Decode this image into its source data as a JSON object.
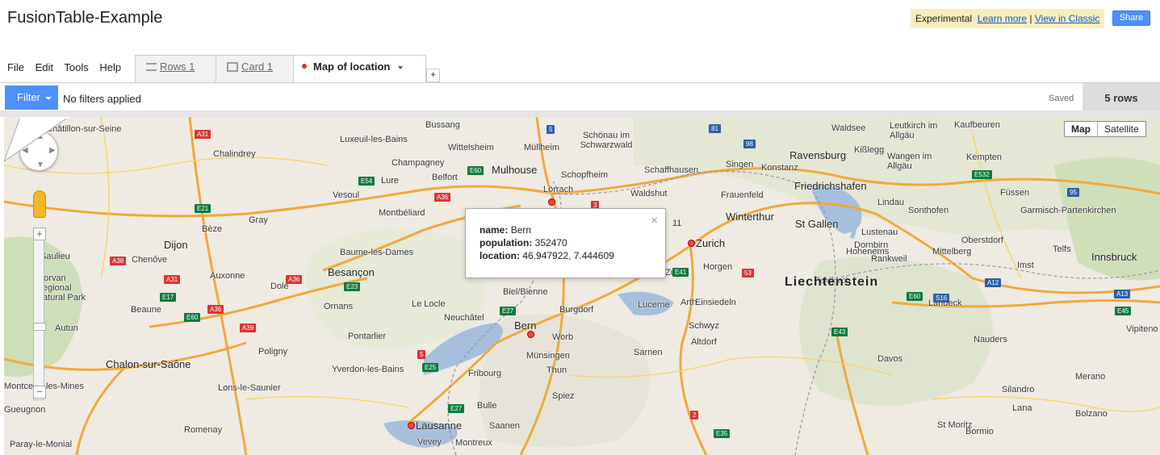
{
  "app": {
    "title": "FusionTable-Example",
    "experimental_label": "Experimental",
    "learn_more": "Learn more",
    "separator": "|",
    "view_classic": "View in Classic",
    "share_label": "Share"
  },
  "menu": [
    "File",
    "Edit",
    "Tools",
    "Help"
  ],
  "tabs": [
    {
      "label": "Rows 1",
      "icon": "rows-icon"
    },
    {
      "label": "Card 1",
      "icon": "card-icon"
    },
    {
      "label": "Map of location",
      "icon": "map-pin-icon"
    }
  ],
  "add_tab_label": "+",
  "filterbar": {
    "filter_label": "Filter",
    "no_filters": "No filters applied",
    "saved": "Saved",
    "rows_count": "5 rows"
  },
  "map": {
    "type_buttons": {
      "map": "Map",
      "satellite": "Satellite"
    },
    "zoom_in": "+",
    "zoom_out": "−",
    "info": {
      "name_key": "name:",
      "name_value": "Bern",
      "population_key": "population:",
      "population_value": "352470",
      "location_key": "location:",
      "location_value": "46.947922, 7.444609",
      "close": "×"
    },
    "country_label": "Liechtenstein",
    "cities": [
      "Châtillon-sur-Seine",
      "Bussang",
      "Schönau im Schwarzwald",
      "Luxeuil-les-Bains",
      "Wittelsheim",
      "Müllheim",
      "Chalindrey",
      "Champagney",
      "Mulhouse",
      "Schopfheim",
      "Belfort",
      "Lörrach",
      "Waldshut",
      "Schaffhausen",
      "Singen",
      "Konstanz",
      "Ravensburg",
      "Kißlegg",
      "Kaufbeuren",
      "Leutkirch im Allgäu",
      "Waldsee",
      "Kempten",
      "Wangen im Allgäu",
      "Friedrichshafen",
      "Lindau",
      "Füssen",
      "Sonthofen",
      "Garmisch-Partenkirchen",
      "Vesoul",
      "Lure",
      "Montbéliard",
      "Frauenfeld",
      "Winterthur",
      "St Gallen",
      "Lustenau",
      "Oberstdorf",
      "Gray",
      "Bèze",
      "Dijon",
      "Baume-les-Dames",
      "Zurich",
      "Dornbirn",
      "Hohenems",
      "Mittelberg",
      "Telfs",
      "Saulieu",
      "Chenôve",
      "Besançon",
      "Horgen",
      "Rankweil",
      "Imst",
      "Innsbruck",
      "Morvan Regional Natural Park",
      "Auxonne",
      "Biel/Bienne",
      "Zug",
      "Feldkirch",
      "Beaune",
      "Dole",
      "Ornans",
      "Le Locle",
      "Neuchâtel",
      "Burgdorf",
      "Lucerne",
      "Arth",
      "Einsiedeln",
      "Landeck",
      "Autun",
      "Pontarlier",
      "Bern",
      "Worb",
      "Schwyz",
      "Vipiteno",
      "Poligny",
      "Münsingen",
      "Sarnen",
      "Altdorf",
      "Nauders",
      "Chalon-sur-Saône",
      "Yverdon-les-Bains",
      "Fribourg",
      "Thun",
      "Davos",
      "Merano",
      "Montceau-les-Mines",
      "Lons-le-Saunier",
      "Spiez",
      "Silandro",
      "Gueugnon",
      "Bulle",
      "Lana",
      "Lausanne",
      "Saanen",
      "St Moritz",
      "Bolzano",
      "Romenay",
      "Vevey",
      "Montreux",
      "Bormio",
      "Paray-le-Monial"
    ],
    "roads": [
      "A31",
      "5",
      "81",
      "98",
      "E60",
      "E54",
      "E21",
      "A36",
      "95",
      "E532",
      "A38",
      "A31",
      "E23",
      "A36",
      "3",
      "11",
      "E41",
      "53",
      "E17",
      "A36",
      "E27",
      "A39",
      "A12",
      "E60",
      "S16",
      "A13",
      "E45",
      "E60",
      "E43",
      "5",
      "E25",
      "E27",
      "2",
      "E35"
    ]
  }
}
